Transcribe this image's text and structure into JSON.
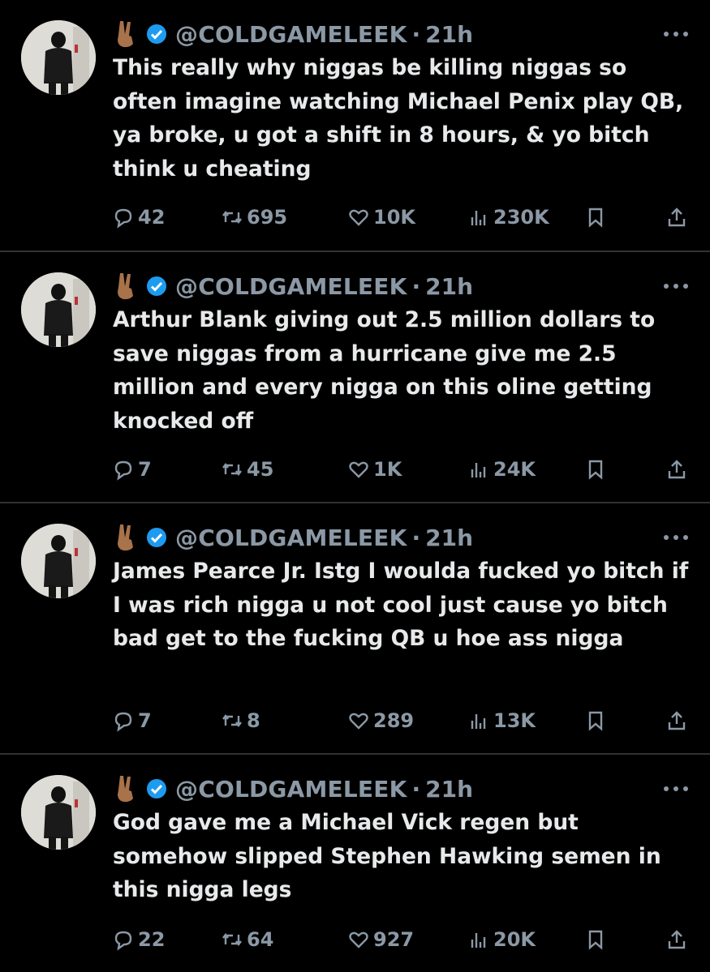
{
  "colors": {
    "background": "#000000",
    "text": "#e7e9ea",
    "muted": "#8b98a5",
    "verified": "#1d9bf0",
    "divider": "#2f3336"
  },
  "tweets": [
    {
      "handle": "@COLDGAMELEEK",
      "separator": "·",
      "time": "21h",
      "text": "This really why niggas be killing niggas so often imagine watching Michael Penix play QB, ya broke, u got a shift in 8 hours, & yo bitch think u cheating",
      "replies": "42",
      "retweets": "695",
      "likes": "10K",
      "views": "230K",
      "icons": {
        "reply": "reply-icon",
        "retweet": "retweet-icon",
        "like": "heart-icon",
        "views": "views-icon",
        "bookmark": "bookmark-icon",
        "share": "share-icon"
      }
    },
    {
      "handle": "@COLDGAMELEEK",
      "separator": "·",
      "time": "21h",
      "text": "Arthur Blank giving out 2.5 million dollars to save niggas from a hurricane give me 2.5 million and every nigga on this oline getting knocked off",
      "replies": "7",
      "retweets": "45",
      "likes": "1K",
      "views": "24K",
      "icons": {
        "reply": "reply-icon",
        "retweet": "retweet-icon",
        "like": "heart-icon",
        "views": "views-icon",
        "bookmark": "bookmark-icon",
        "share": "share-icon"
      }
    },
    {
      "handle": "@COLDGAMELEEK",
      "separator": "·",
      "time": "21h",
      "text": "James Pearce Jr. Istg I woulda fucked yo bitch if I was rich nigga u not cool just cause yo bitch bad get to the fucking QB u hoe ass nigga",
      "replies": "7",
      "retweets": "8",
      "likes": "289",
      "views": "13K",
      "icons": {
        "reply": "reply-icon",
        "retweet": "retweet-icon",
        "like": "heart-icon",
        "views": "views-icon",
        "bookmark": "bookmark-icon",
        "share": "share-icon"
      }
    },
    {
      "handle": "@COLDGAMELEEK",
      "separator": "·",
      "time": "21h",
      "text": "God gave me a Michael Vick regen but somehow slipped Stephen Hawking semen in this nigga legs",
      "replies": "22",
      "retweets": "64",
      "likes": "927",
      "views": "20K",
      "icons": {
        "reply": "reply-icon",
        "retweet": "retweet-icon",
        "like": "heart-icon",
        "views": "views-icon",
        "bookmark": "bookmark-icon",
        "share": "share-icon"
      }
    }
  ]
}
